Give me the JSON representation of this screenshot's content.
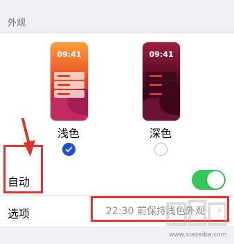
{
  "section": {
    "title": "外观"
  },
  "appearance": {
    "light": {
      "time": "09:41",
      "label": "浅色",
      "selected": true
    },
    "dark": {
      "time": "09:41",
      "label": "深色",
      "selected": false
    }
  },
  "auto_row": {
    "label": "自动",
    "toggle_on": true
  },
  "options_row": {
    "label": "选项",
    "value": "22:30 前保持浅色外观",
    "chevron": "›"
  },
  "watermark": {
    "text": "www.xiazaiba.com"
  },
  "colors": {
    "accent": "#1f4fd1",
    "toggle_on": "#34c759",
    "highlight": "#e2322b",
    "secondary_text": "#8e8e93",
    "background": "#efeff4"
  },
  "icons": {
    "check": "checkmark-icon",
    "chevron": "chevron-right-icon",
    "arrow": "down-arrow-annotation"
  }
}
